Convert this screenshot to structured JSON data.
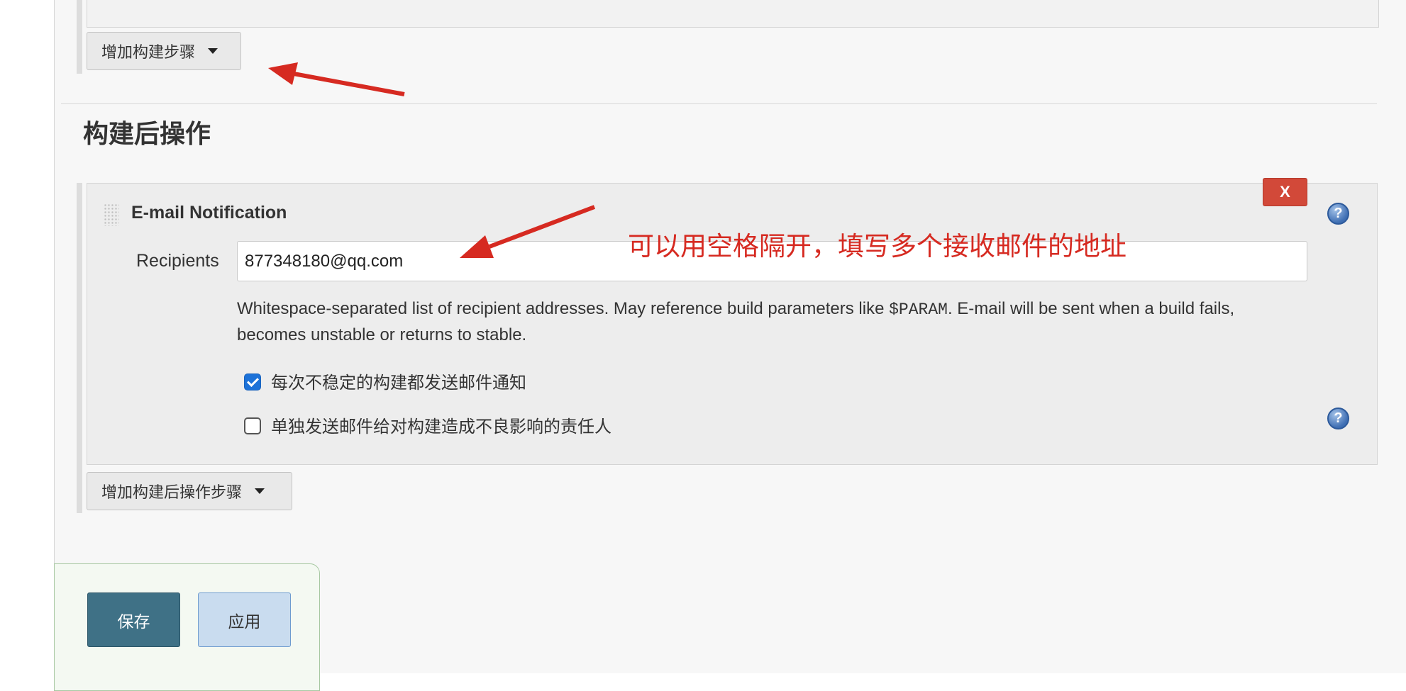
{
  "build_steps": {
    "add_step_label": "增加构建步骤"
  },
  "post_build": {
    "section_title": "构建后操作",
    "email_notification": {
      "title": "E-mail Notification",
      "delete_label": "X",
      "recipients_label": "Recipients",
      "recipients_value": "877348180@qq.com",
      "help_text_before": "Whitespace-separated list of recipient addresses. May reference build parameters like ",
      "help_text_code": "$PARAM",
      "help_text_after": ". E-mail will be sent when a build fails, becomes unstable or returns to stable.",
      "checkbox_unstable": {
        "label": "每次不稳定的构建都发送邮件通知",
        "checked": true
      },
      "checkbox_individual": {
        "label": "单独发送邮件给对构建造成不良影响的责任人",
        "checked": false
      }
    },
    "add_post_step_label": "增加构建后操作步骤"
  },
  "annotation": {
    "text": "可以用空格隔开，填写多个接收邮件的地址",
    "color": "#d62a21"
  },
  "actions": {
    "save_label": "保存",
    "apply_label": "应用"
  },
  "help_icon_glyph": "?",
  "colors": {
    "save_button": "#3f7186",
    "apply_button": "#c9dcef",
    "delete_button": "#d24939",
    "checkbox_checked": "#1d72d8"
  }
}
